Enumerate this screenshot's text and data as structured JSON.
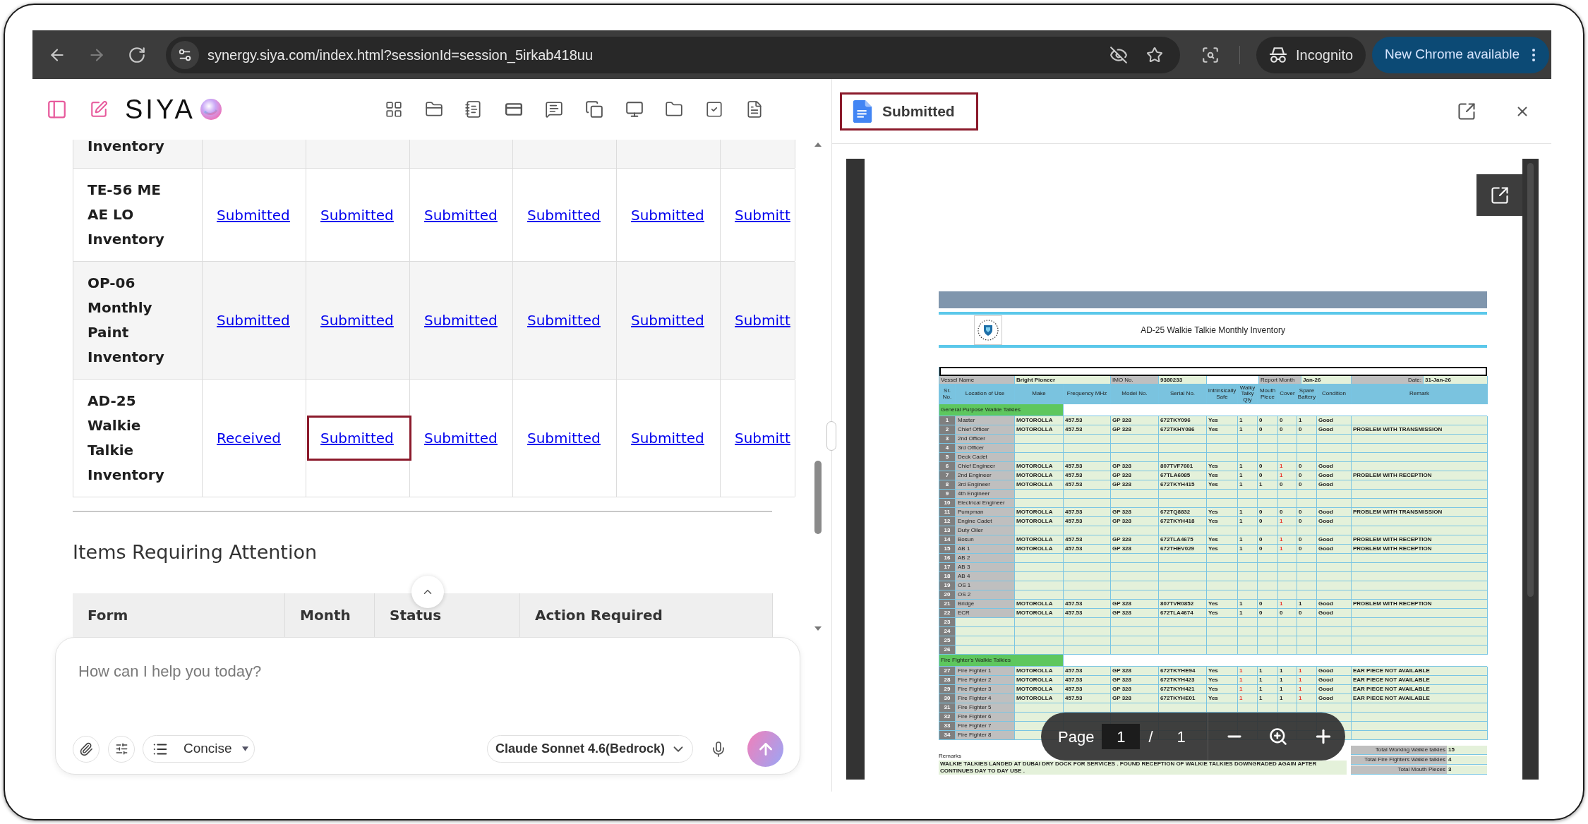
{
  "browser": {
    "url": "synergy.siya.com/index.html?sessionId=session_5irkab418uu",
    "profile": "Incognito",
    "update_button": "New Chrome available"
  },
  "app": {
    "logo": "SIYA",
    "forms_table": {
      "rows": [
        {
          "form": "Inventory"
        },
        {
          "form": "TE-56 ME AE LO Inventory",
          "cells": [
            {
              "text": "Submitted",
              "highlighted": false
            },
            {
              "text": "Submitted",
              "highlighted": false
            },
            {
              "text": "Submitted",
              "highlighted": false
            },
            {
              "text": "Submitted",
              "highlighted": false
            },
            {
              "text": "Submitted",
              "highlighted": false
            },
            {
              "text": "Submitt",
              "highlighted": false
            }
          ]
        },
        {
          "form": "OP-06 Monthly Paint Inventory",
          "cells": [
            {
              "text": "Submitted",
              "highlighted": false
            },
            {
              "text": "Submitted",
              "highlighted": false
            },
            {
              "text": "Submitted",
              "highlighted": false
            },
            {
              "text": "Submitted",
              "highlighted": false
            },
            {
              "text": "Submitted",
              "highlighted": false
            },
            {
              "text": "Submitt",
              "highlighted": false
            }
          ]
        },
        {
          "form": "AD-25 Walkie Talkie Inventory",
          "cells": [
            {
              "text": "Received",
              "highlighted": false
            },
            {
              "text": "Submitted",
              "highlighted": true
            },
            {
              "text": "Submitted",
              "highlighted": false
            },
            {
              "text": "Submitted",
              "highlighted": false
            },
            {
              "text": "Submitted",
              "highlighted": false
            },
            {
              "text": "Submitt",
              "highlighted": false
            }
          ]
        }
      ]
    },
    "attention": {
      "title": "Items Requiring Attention",
      "columns": [
        "Form",
        "Month",
        "Status",
        "Action Required"
      ]
    },
    "composer": {
      "placeholder": "How can I help you today?",
      "style": "Concise",
      "model": "Claude Sonnet 4.6(Bedrock)"
    }
  },
  "viewer": {
    "title": "Submitted",
    "title_highlighted": true,
    "document": {
      "title": "AD-25 Walkie Talkie Monthly Inventory",
      "info": [
        {
          "label": "Vessel Name",
          "value": "Bright Pioneer"
        },
        {
          "label": "IMO No.",
          "value": "9380233"
        },
        {
          "label": "Report Month",
          "value": "Jan-26"
        },
        {
          "label": "Date:",
          "value": "31-Jan-26"
        }
      ],
      "columns": [
        "Sr. No.",
        "Location of Use",
        "Make",
        "Frequency MHz",
        "Model No.",
        "Serial No.",
        "Intrinsically Safe",
        "Walky Talky Qty",
        "Mouth Piece",
        "Cover",
        "Spare Battery",
        "Condition",
        "Remark"
      ],
      "sections": [
        {
          "title": "General Purpose Walkie Talkies",
          "rows": [
            {
              "no": "1",
              "location": "Master",
              "values": [
                "MOTOROLLA",
                "457.53",
                "GP 328",
                "672TKY096",
                "Yes",
                "1",
                "0",
                "0",
                "1",
                "Good"
              ]
            },
            {
              "no": "2",
              "location": "Chief Officer",
              "values": [
                "MOTOROLLA",
                "457.53",
                "GP 328",
                "672TKHY086",
                "Yes",
                "1",
                "0",
                "0",
                "0",
                "Good"
              ],
              "remark": "PROBLEM WITH TRANSMISSION"
            },
            {
              "no": "3",
              "location": "2nd Officer"
            },
            {
              "no": "4",
              "location": "3rd Officer"
            },
            {
              "no": "5",
              "location": "Deck Cadet"
            },
            {
              "no": "6",
              "location": "Chief Engineer",
              "values": [
                "MOTOROLLA",
                "457.53",
                "GP 328",
                "807TVF7601",
                "Yes",
                "1",
                "0",
                {
                  "text": "1",
                  "color": "#e8322a"
                },
                "0",
                "Good"
              ]
            },
            {
              "no": "7",
              "location": "2nd Engineer",
              "values": [
                "MOTOROLLA",
                "457.53",
                "GP 328",
                "67TLA6085",
                "Yes",
                "1",
                "0",
                {
                  "text": "1",
                  "color": "#e8322a"
                },
                "0",
                "Good"
              ],
              "remark": "PROBLEM WITH RECEPTION"
            },
            {
              "no": "8",
              "location": "3rd Engineer",
              "values": [
                "MOTOROLLA",
                "457.53",
                "GP 328",
                "672TKYH415",
                "Yes",
                "1",
                "1",
                "0",
                "0",
                "Good"
              ]
            },
            {
              "no": "9",
              "location": "4th Engineer"
            },
            {
              "no": "10",
              "location": "Electrical Engineer"
            },
            {
              "no": "11",
              "location": "Pumpman",
              "values": [
                "MOTOROLLA",
                "457.53",
                "GP 328",
                "672TQ8832",
                "Yes",
                "1",
                "0",
                "0",
                "0",
                "Good"
              ],
              "remark": "PROBLEM WITH TRANSMISSION"
            },
            {
              "no": "12",
              "location": "Engine Cadet",
              "values": [
                "MOTOROLLA",
                "457.53",
                "GP 328",
                "672TKYH418",
                "Yes",
                "1",
                "0",
                {
                  "text": "1",
                  "color": "#e8322a"
                },
                "0",
                "Good"
              ]
            },
            {
              "no": "13",
              "location": "Duty Oiler"
            },
            {
              "no": "14",
              "location": "Bosun",
              "values": [
                "MOTOROLLA",
                "457.53",
                "GP 328",
                "672TLA4675",
                "Yes",
                "1",
                "0",
                {
                  "text": "1",
                  "color": "#e8322a"
                },
                "0",
                "Good"
              ],
              "remark": "PROBLEM WITH RECEPTION"
            },
            {
              "no": "15",
              "location": "AB 1",
              "values": [
                "MOTOROLLA",
                "457.53",
                "GP 328",
                "672THEV029",
                "Yes",
                "1",
                "0",
                {
                  "text": "1",
                  "color": "#e8322a"
                },
                "0",
                "Good"
              ],
              "remark": "PROBLEM WITH RECEPTION"
            },
            {
              "no": "16",
              "location": "AB 2"
            },
            {
              "no": "17",
              "location": "AB 3"
            },
            {
              "no": "18",
              "location": "AB 4"
            },
            {
              "no": "19",
              "location": "OS 1"
            },
            {
              "no": "20",
              "location": "OS 2"
            },
            {
              "no": "21",
              "location": "Bridge",
              "values": [
                "MOTOROLLA",
                "457.53",
                "GP 328",
                "807TVR0852",
                "Yes",
                "1",
                "0",
                {
                  "text": "1",
                  "color": "#e8322a"
                },
                "1",
                "Good"
              ],
              "remark": "PROBLEM WITH RECEPTION"
            },
            {
              "no": "22",
              "location": "ECR",
              "values": [
                "MOTOROLLA",
                "457.53",
                "GP 328",
                "672TLA4674",
                "Yes",
                "1",
                "0",
                "0",
                "0",
                "Good"
              ]
            },
            {
              "no": "23"
            },
            {
              "no": "24"
            },
            {
              "no": "25"
            },
            {
              "no": "26"
            }
          ]
        },
        {
          "title": "Fire Fighter's Walkie Talkies",
          "rows": [
            {
              "no": "27",
              "location": "Fire Fighter 1",
              "values": [
                "MOTOROLLA",
                "457.53",
                "GP 328",
                "672TKYHE94",
                "Yes",
                {
                  "text": "1",
                  "color": "#e8322a"
                },
                "1",
                "1",
                {
                  "text": "1",
                  "color": "#e8322a"
                },
                "Good"
              ],
              "remark": "EAR PIECE NOT AVAILABLE"
            },
            {
              "no": "28",
              "location": "Fire Fighter 2",
              "values": [
                "MOTOROLLA",
                "457.53",
                "GP 328",
                "672TKYH423",
                "Yes",
                {
                  "text": "1",
                  "color": "#e8322a"
                },
                "1",
                "1",
                {
                  "text": "1",
                  "color": "#e8322a"
                },
                "Good"
              ],
              "remark": "EAR PIECE NOT AVAILABLE"
            },
            {
              "no": "29",
              "location": "Fire Fighter 3",
              "values": [
                "MOTOROLLA",
                "457.53",
                "GP 328",
                "672TKYH421",
                "Yes",
                {
                  "text": "1",
                  "color": "#e8322a"
                },
                "1",
                "1",
                {
                  "text": "1",
                  "color": "#e8322a"
                },
                "Good"
              ],
              "remark": "EAR PIECE NOT AVAILABLE"
            },
            {
              "no": "30",
              "location": "Fire Fighter 4",
              "values": [
                "MOTOROLLA",
                "457.53",
                "GP 328",
                "672TKYHE01",
                "Yes",
                {
                  "text": "1",
                  "color": "#e8322a"
                },
                "1",
                "1",
                {
                  "text": "1",
                  "color": "#e8322a"
                },
                "Good"
              ],
              "remark": "EAR PIECE NOT AVAILABLE"
            },
            {
              "no": "31",
              "location": "Fire Fighter 5"
            },
            {
              "no": "32",
              "location": "Fire Fighter 6"
            },
            {
              "no": "33",
              "location": "Fire Fighter 7"
            },
            {
              "no": "34",
              "location": "Fire Fighter 8"
            }
          ]
        }
      ],
      "remarks_label": "Remarks",
      "remarks": "WALKIE TALKIES LANDED AT DUBAI DRY DOCK FOR SERVICES . FOUND RECEPTION OF WALKIE TALKIES DOWNGRADED AGAIN AFTER CONTINUES DAY TO DAY USE .",
      "totals": [
        {
          "label": "Total Working Walkie talkies",
          "value": "15"
        },
        {
          "label": "Total Fire Fighters Walkie talkies",
          "value": "4"
        },
        {
          "label": "Total Mouth Pieces",
          "value": "3"
        }
      ]
    },
    "pager": {
      "label": "Page",
      "page": "1",
      "separator": "/",
      "total": "1"
    }
  }
}
